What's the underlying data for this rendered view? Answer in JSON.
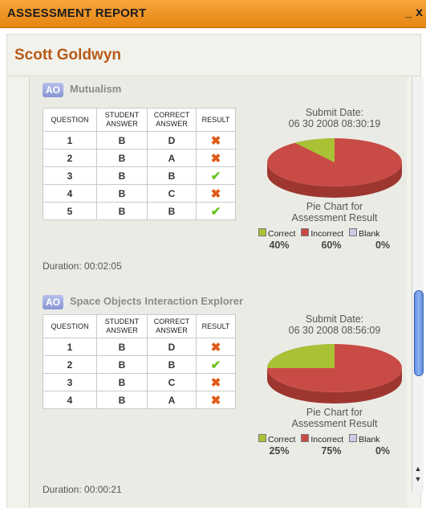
{
  "window": {
    "title": "ASSESSMENT REPORT",
    "close_label": "_ x"
  },
  "student": {
    "name": "Scott Goldwyn"
  },
  "table_headers": {
    "question": "QUESTION",
    "student": "STUDENT ANSWER",
    "correct": "CORRECT ANSWER",
    "result": "RESULT"
  },
  "labels": {
    "submit": "Submit Date:",
    "pie_caption_1": "Pie Chart for",
    "pie_caption_2": "Assessment Result"
  },
  "legend": {
    "correct": "Correct",
    "incorrect": "Incorrect",
    "blank": "Blank"
  },
  "colors": {
    "correct": "#a9c235",
    "incorrect": "#c94b45",
    "blank": "#c9cbe4"
  },
  "sections": [
    {
      "badge": "AO",
      "title": "Mutualism",
      "submit_date": "06 30 2008 08:30:19",
      "rows": [
        {
          "q": "1",
          "student": "B",
          "correct": "D",
          "result": "incorrect"
        },
        {
          "q": "2",
          "student": "B",
          "correct": "A",
          "result": "incorrect"
        },
        {
          "q": "3",
          "student": "B",
          "correct": "B",
          "result": "correct"
        },
        {
          "q": "4",
          "student": "B",
          "correct": "C",
          "result": "incorrect"
        },
        {
          "q": "5",
          "student": "B",
          "correct": "B",
          "result": "correct"
        }
      ],
      "pct": {
        "correct": "40%",
        "incorrect": "60%",
        "blank": "0%"
      },
      "duration": "Duration: 00:02:05"
    },
    {
      "badge": "AO",
      "title": "Space Objects Interaction Explorer",
      "submit_date": "06 30 2008 08:56:09",
      "rows": [
        {
          "q": "1",
          "student": "B",
          "correct": "D",
          "result": "incorrect"
        },
        {
          "q": "2",
          "student": "B",
          "correct": "B",
          "result": "correct"
        },
        {
          "q": "3",
          "student": "B",
          "correct": "C",
          "result": "incorrect"
        },
        {
          "q": "4",
          "student": "B",
          "correct": "A",
          "result": "incorrect"
        }
      ],
      "pct": {
        "correct": "25%",
        "incorrect": "75%",
        "blank": "0%"
      },
      "duration": "Duration: 00:00:21"
    }
  ],
  "icons": {
    "incorrect": "x-mark-icon",
    "correct": "check-mark-icon"
  }
}
